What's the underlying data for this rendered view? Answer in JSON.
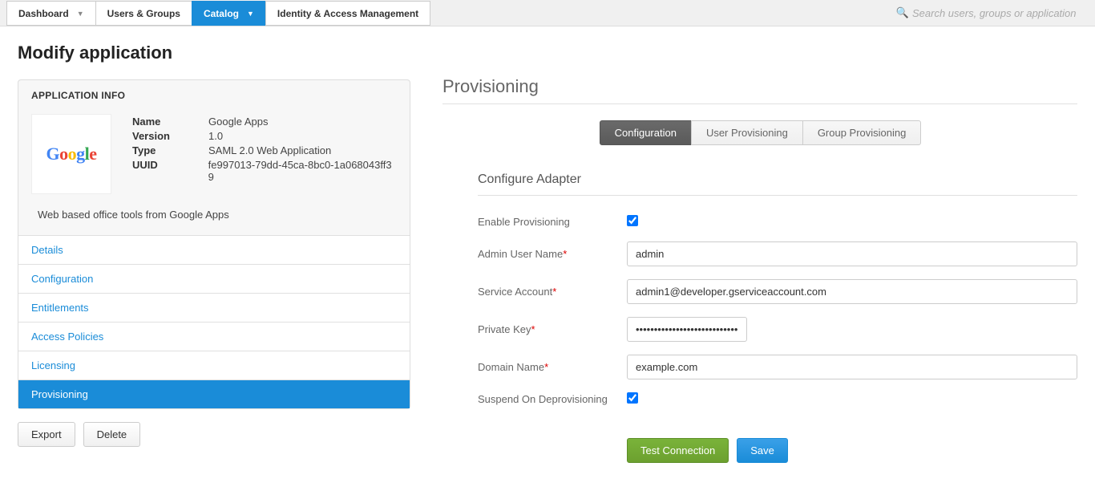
{
  "nav": {
    "tabs": [
      {
        "label": "Dashboard",
        "dropdown": true,
        "active": false
      },
      {
        "label": "Users & Groups",
        "dropdown": false,
        "active": false
      },
      {
        "label": "Catalog",
        "dropdown": true,
        "active": true
      },
      {
        "label": "Identity & Access Management",
        "dropdown": false,
        "active": false
      }
    ],
    "search_placeholder": "Search users, groups or application"
  },
  "page_title": "Modify application",
  "app_info": {
    "header": "APPLICATION INFO",
    "logo_text": "Google",
    "fields": {
      "name_label": "Name",
      "name_value": "Google Apps",
      "version_label": "Version",
      "version_value": "1.0",
      "type_label": "Type",
      "type_value": "SAML 2.0 Web Application",
      "uuid_label": "UUID",
      "uuid_value": "fe997013-79dd-45ca-8bc0-1a068043ff39"
    },
    "description": "Web based office tools from Google Apps"
  },
  "side_nav": [
    {
      "label": "Details",
      "active": false
    },
    {
      "label": "Configuration",
      "active": false
    },
    {
      "label": "Entitlements",
      "active": false
    },
    {
      "label": "Access Policies",
      "active": false
    },
    {
      "label": "Licensing",
      "active": false
    },
    {
      "label": "Provisioning",
      "active": true
    }
  ],
  "left_actions": {
    "export": "Export",
    "delete": "Delete"
  },
  "right": {
    "title": "Provisioning",
    "subtabs": [
      {
        "label": "Configuration",
        "active": true
      },
      {
        "label": "User Provisioning",
        "active": false
      },
      {
        "label": "Group Provisioning",
        "active": false
      }
    ],
    "form_title": "Configure Adapter",
    "fields": {
      "enable_label": "Enable Provisioning",
      "enable_checked": true,
      "admin_label": "Admin User Name",
      "admin_value": "admin",
      "service_label": "Service Account",
      "service_value": "admin1@developer.gserviceaccount.com",
      "pkey_label": "Private Key",
      "pkey_value": "••••••••••••••••••••••••••••",
      "domain_label": "Domain Name",
      "domain_value": "example.com",
      "suspend_label": "Suspend On Deprovisioning",
      "suspend_checked": true
    },
    "actions": {
      "test": "Test Connection",
      "save": "Save"
    }
  }
}
